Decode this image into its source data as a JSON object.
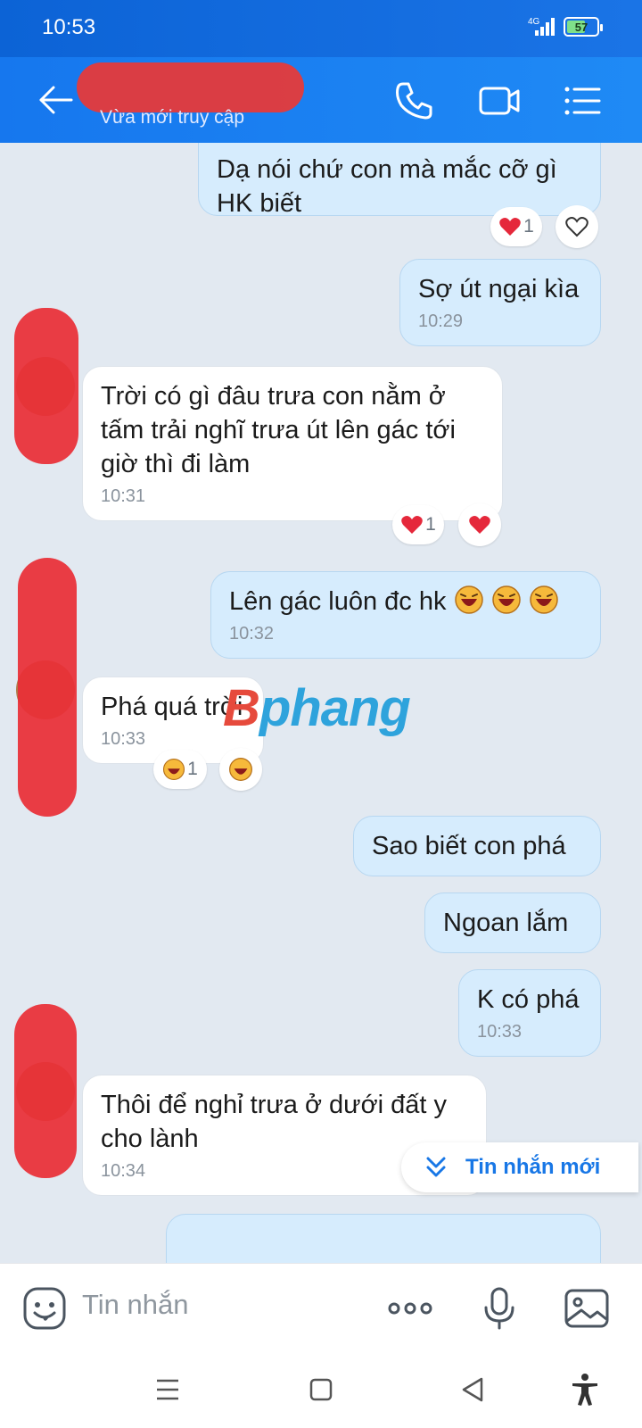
{
  "status_bar": {
    "time": "10:53",
    "network": "4G",
    "battery": "57"
  },
  "header": {
    "contact_status": "Vừa mới truy cập"
  },
  "messages": [
    {
      "side": "out",
      "text": "Dạ nói chứ con mà mắc cỡ gì HK biết",
      "time": "",
      "reaction_count": "1"
    },
    {
      "side": "out",
      "text": "Sợ út ngại kìa",
      "time": "10:29"
    },
    {
      "side": "in",
      "text": "Trời có gì đâu trưa con nằm ở tấm trải nghĩ trưa út lên gác tới giờ thì đi làm",
      "time": "10:31",
      "reaction_count": "1"
    },
    {
      "side": "out",
      "text": "Lên gác luôn đc hk",
      "time": "10:32"
    },
    {
      "side": "in",
      "text": "Phá quá trời",
      "time": "10:33",
      "reaction_count": "1"
    },
    {
      "side": "out",
      "text": "Sao biết con phá",
      "time": ""
    },
    {
      "side": "out",
      "text": "Ngoan lắm",
      "time": ""
    },
    {
      "side": "out",
      "text": "K có phá",
      "time": "10:33"
    },
    {
      "side": "in",
      "text": "Thôi để nghỉ trưa ở dưới đất y cho lành",
      "time": "10:34"
    }
  ],
  "watermark": {
    "b": "B",
    "rest": "phang"
  },
  "new_messages_pill": "Tin nhắn mới",
  "input": {
    "placeholder": "Tin nhắn"
  },
  "colors": {
    "header": "#1677ee",
    "out_bubble": "#d6ecfd",
    "accent": "#1877e6",
    "heart": "#e5283b"
  }
}
